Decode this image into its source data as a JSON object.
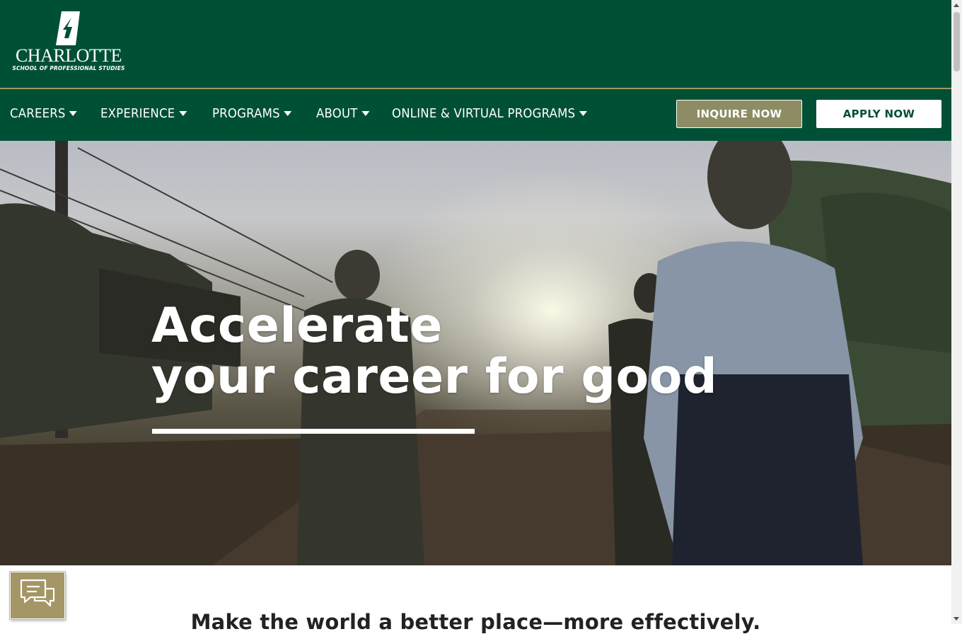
{
  "brand": {
    "wordmark": "CHARLOTTE",
    "subtitle": "SCHOOL OF PROFESSIONAL STUDIES"
  },
  "nav": {
    "items": [
      {
        "label": "CAREERS"
      },
      {
        "label": "EXPERIENCE"
      },
      {
        "label": "PROGRAMS"
      },
      {
        "label": "ABOUT"
      },
      {
        "label": "ONLINE & VIRTUAL PROGRAMS"
      }
    ],
    "inquire_label": "INQUIRE NOW",
    "apply_label": "APPLY NOW"
  },
  "hero": {
    "heading_line1": "Accelerate",
    "heading_line2": "your career for good"
  },
  "intro": {
    "tagline": "Make the world a better place—more effectively."
  },
  "icons": {
    "logo": "uncc-pickaxe-c-logo",
    "nav_dropdown": "caret-down-icon",
    "chat": "chat-bubbles-icon"
  },
  "colors": {
    "brand_green": "#005035",
    "gold": "#a49665",
    "inquire_button": "#8e8c64",
    "apply_button_text": "#005035"
  }
}
